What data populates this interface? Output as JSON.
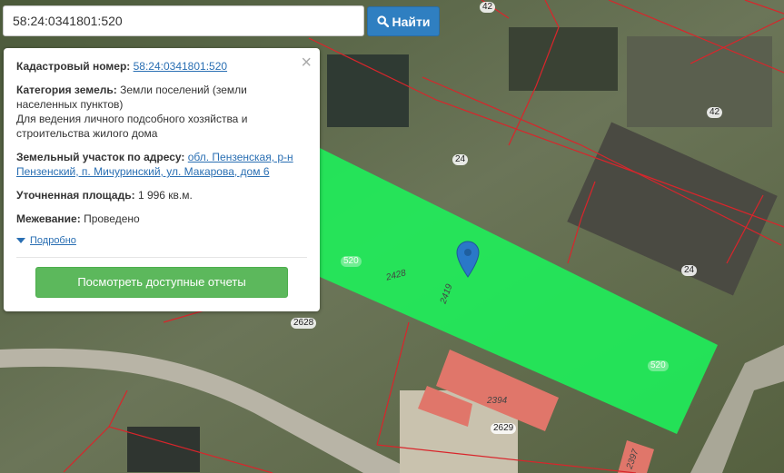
{
  "search": {
    "value": "58:24:0341801:520",
    "button_label": "Найти"
  },
  "panel": {
    "cadastral_label": "Кадастровый номер:",
    "cadastral_value": "58:24:0341801:520",
    "category_label": "Категория земель:",
    "category_value": "Земли поселений (земли населенных пунктов)",
    "usage_text": "Для ведения личного подсобного хозяйства и строительства жилого дома",
    "address_label": "Земельный участок по адресу:",
    "address_value": "обл. Пензенская, р-н Пензенский, п. Мичуринский, ул. Макарова, дом 6",
    "area_label": "Уточненная площадь:",
    "area_value": "1 996 кв.м.",
    "survey_label": "Межевание:",
    "survey_value": "Проведено",
    "details_link": "Подробно",
    "report_button": "Посмотреть доступные отчеты",
    "close_glyph": "×"
  },
  "map": {
    "labels": {
      "l42_top": "42",
      "l42_right": "42",
      "l24_center": "24",
      "l24_right": "24",
      "l520_left": "520",
      "l520_right": "520",
      "l2628": "2628",
      "l2629": "2629",
      "l2428": "2428",
      "l2419": "2419",
      "l2394": "2394",
      "l2397": "2397"
    },
    "colors": {
      "highlight": "#1cf25a",
      "boundary": "#d9252b",
      "building": "#e0766a"
    }
  }
}
